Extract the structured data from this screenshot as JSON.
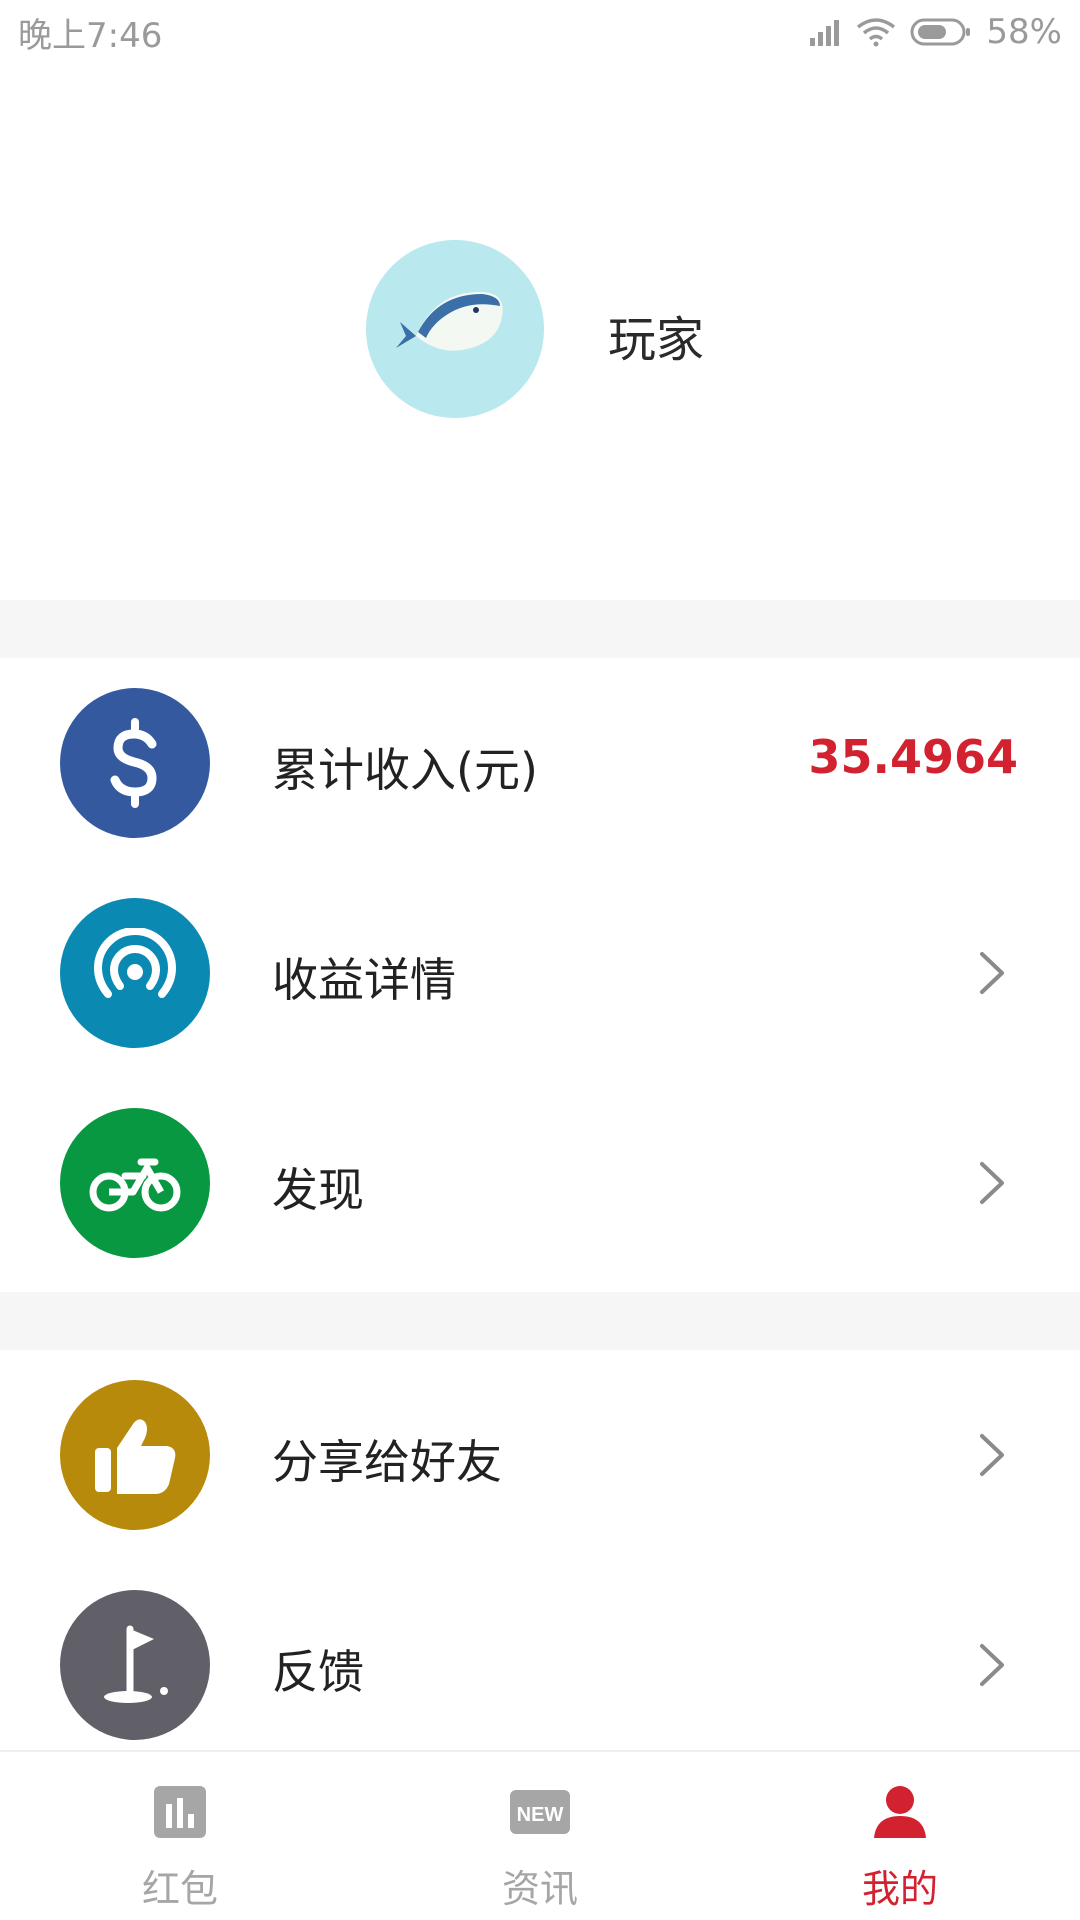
{
  "status_bar": {
    "time": "晚上7:46",
    "battery": "58%",
    "icons": [
      "signal-icon",
      "wifi-icon",
      "battery-icon"
    ]
  },
  "profile": {
    "username": "玩家",
    "avatar_icon": "whale-icon"
  },
  "menu": {
    "income": {
      "label": "累计收入(元)",
      "value": "35.4964",
      "icon": "dollar-icon",
      "color": "#34599f"
    },
    "earnings_detail": {
      "label": "收益详情",
      "icon": "broadcast-icon",
      "color": "#0a8ab2"
    },
    "discover": {
      "label": "发现",
      "icon": "bicycle-icon",
      "color": "#089841"
    },
    "share": {
      "label": "分享给好友",
      "icon": "thumbs-up-icon",
      "color": "#b88a0b"
    },
    "feedback": {
      "label": "反馈",
      "icon": "flag-icon",
      "color": "#616069"
    }
  },
  "bottom_nav": {
    "items": [
      {
        "label": "红包",
        "icon": "bar-chart-icon",
        "active": false
      },
      {
        "label": "资讯",
        "icon": "new-badge-icon",
        "badge_text": "NEW",
        "active": false
      },
      {
        "label": "我的",
        "icon": "person-icon",
        "active": true
      }
    ]
  },
  "colors": {
    "accent": "#d3222f",
    "inactive": "#a6a6a6",
    "separator": "#f6f6f6"
  }
}
